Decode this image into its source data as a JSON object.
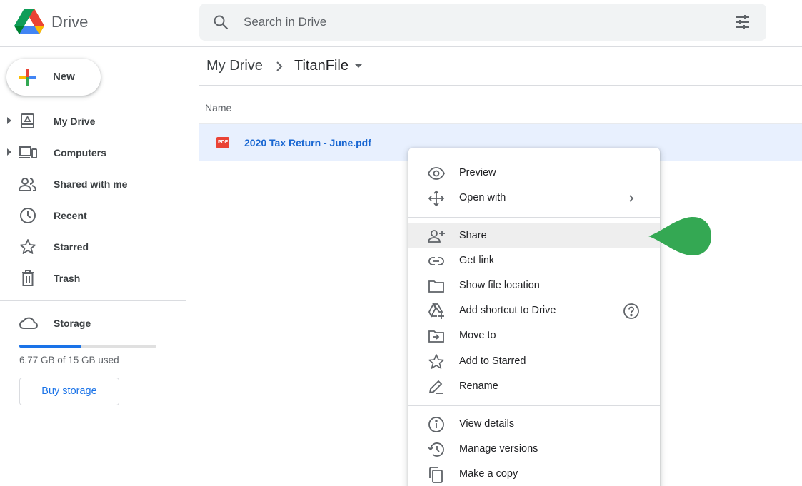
{
  "app": {
    "brand": "Drive",
    "logo_icon": "google-drive-logo"
  },
  "search": {
    "placeholder": "Search in Drive",
    "icon": "search-icon",
    "options_icon": "tune-icon"
  },
  "sidebar": {
    "new_label": "New",
    "items": [
      {
        "label": "My Drive",
        "icon": "my-drive-icon",
        "expandable": true
      },
      {
        "label": "Computers",
        "icon": "computers-icon",
        "expandable": true
      },
      {
        "label": "Shared with me",
        "icon": "people-icon",
        "expandable": false
      },
      {
        "label": "Recent",
        "icon": "clock-icon",
        "expandable": false
      },
      {
        "label": "Starred",
        "icon": "star-icon",
        "expandable": false
      },
      {
        "label": "Trash",
        "icon": "trash-icon",
        "expandable": false
      }
    ],
    "storage": {
      "label": "Storage",
      "used_text": "6.77 GB of 15 GB used",
      "used_fraction": 0.451,
      "buy_label": "Buy storage"
    }
  },
  "breadcrumb": {
    "root": "My Drive",
    "current": "TitanFile"
  },
  "file_list": {
    "column_name": "Name",
    "files": [
      {
        "name": "2020 Tax Return - June.pdf",
        "type_badge": "PDF",
        "selected": true
      }
    ]
  },
  "context_menu": {
    "groups": [
      [
        {
          "label": "Preview",
          "icon": "eye-icon"
        },
        {
          "label": "Open with",
          "icon": "move-arrows-icon",
          "submenu": true
        }
      ],
      [
        {
          "label": "Share",
          "icon": "person-add-icon",
          "highlighted": true
        },
        {
          "label": "Get link",
          "icon": "link-icon"
        },
        {
          "label": "Show file location",
          "icon": "folder-icon"
        },
        {
          "label": "Add shortcut to Drive",
          "icon": "add-shortcut-icon",
          "help": true
        },
        {
          "label": "Move to",
          "icon": "move-to-folder-icon"
        },
        {
          "label": "Add to Starred",
          "icon": "star-outline-icon"
        },
        {
          "label": "Rename",
          "icon": "pencil-icon"
        }
      ],
      [
        {
          "label": "View details",
          "icon": "info-icon"
        },
        {
          "label": "Manage versions",
          "icon": "history-icon"
        },
        {
          "label": "Make a copy",
          "icon": "copy-icon"
        }
      ]
    ]
  },
  "colors": {
    "accent": "#1a73e8",
    "selected_row": "#e8f0fe",
    "pointer": "#34a853"
  }
}
